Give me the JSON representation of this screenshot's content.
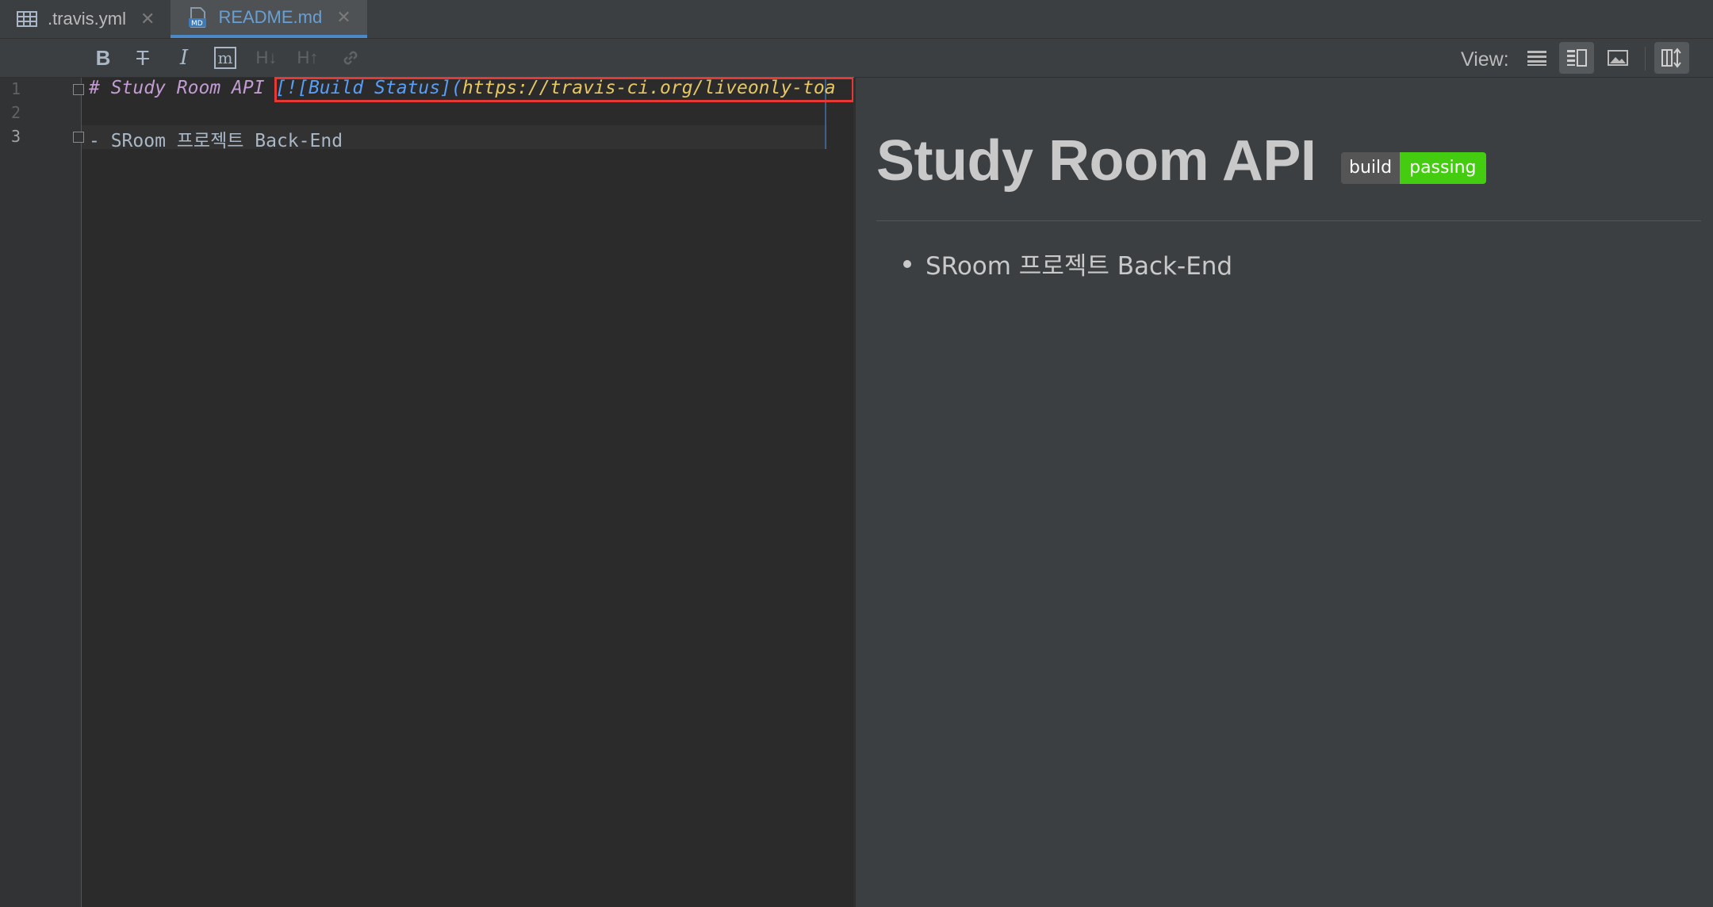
{
  "tabs": [
    {
      "label": ".travis.yml",
      "icon": "table-icon"
    },
    {
      "label": "README.md",
      "icon": "markdown-file-icon"
    }
  ],
  "toolbar": {
    "bold": "B",
    "strike": "T",
    "italic": "I",
    "code": "m",
    "header_down": "H↓",
    "header_up": "H↑",
    "link_icon": "link-icon",
    "view_label": "View:"
  },
  "editor": {
    "line_numbers": [
      "1",
      "2",
      "3"
    ],
    "line1_heading": "# Study Room API ",
    "line1_link": "[![Build Status](",
    "line1_url": "https://travis-ci.org/liveonly-toa",
    "line3": "- SRoom 프로젝트 Back-End"
  },
  "preview": {
    "title": "Study Room API",
    "badge_left": "build",
    "badge_right": "passing",
    "items": [
      "SRoom 프로젝트 Back-End"
    ]
  },
  "colors": {
    "accent": "#4a88c7",
    "badge_green": "#44cc11",
    "highlight_red": "#e53935"
  }
}
